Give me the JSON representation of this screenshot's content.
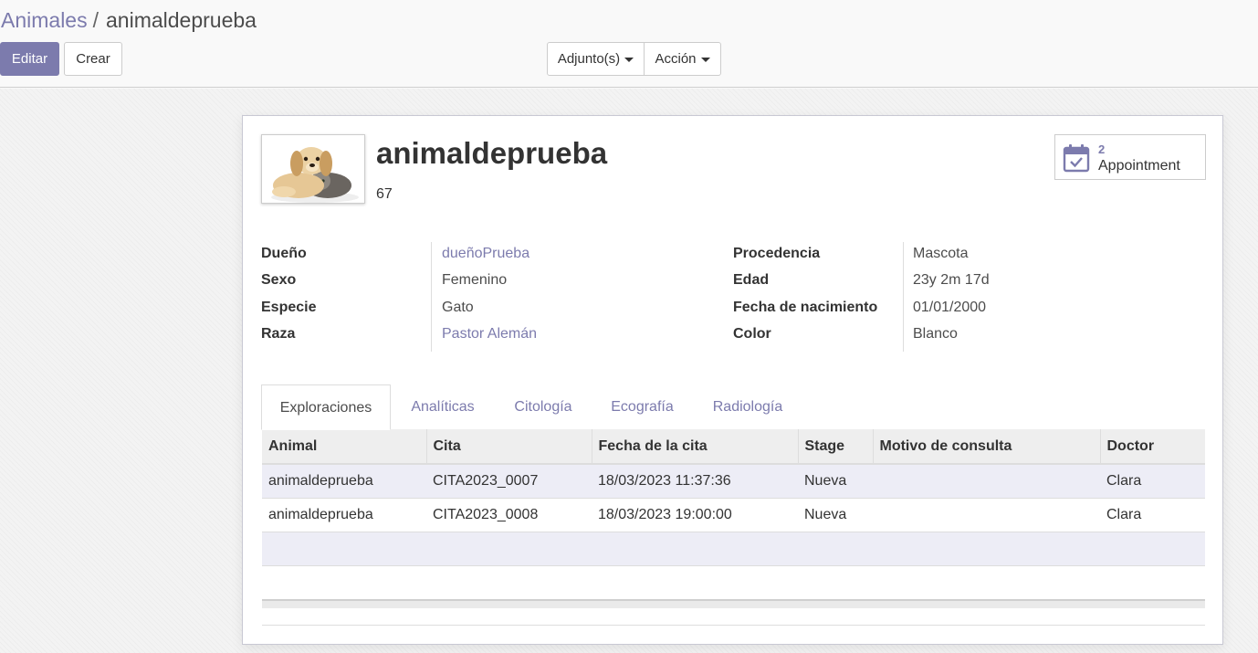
{
  "breadcrumb": {
    "parent": "Animales",
    "current": "animaldeprueba",
    "separator": "/"
  },
  "buttons": {
    "edit": "Editar",
    "create": "Crear",
    "attachments": "Adjunto(s)",
    "action": "Acción"
  },
  "record": {
    "name": "animaldeprueba",
    "number": "67",
    "smart_button": {
      "count": "2",
      "label": "Appointment",
      "icon": "calendar-check-icon"
    }
  },
  "fields_left": [
    {
      "label": "Dueño",
      "value": "dueñoPrueba",
      "link": true
    },
    {
      "label": "Sexo",
      "value": "Femenino",
      "link": false
    },
    {
      "label": "Especie",
      "value": "Gato",
      "link": false
    },
    {
      "label": "Raza",
      "value": "Pastor Alemán",
      "link": true
    }
  ],
  "fields_right": [
    {
      "label": "Procedencia",
      "value": "Mascota"
    },
    {
      "label": "Edad",
      "value": "23y 2m 17d"
    },
    {
      "label": "Fecha de nacimiento",
      "value": "01/01/2000"
    },
    {
      "label": "Color",
      "value": "Blanco"
    }
  ],
  "tabs": [
    "Exploraciones",
    "Analíticas",
    "Citología",
    "Ecografía",
    "Radiología"
  ],
  "active_tab": "Exploraciones",
  "table": {
    "headers": [
      "Animal",
      "Cita",
      "Fecha de la cita",
      "Stage",
      "Motivo de consulta",
      "Doctor"
    ],
    "rows": [
      [
        "animaldeprueba",
        "CITA2023_0007",
        "18/03/2023 11:37:36",
        "Nueva",
        "",
        "Clara"
      ],
      [
        "animaldeprueba",
        "CITA2023_0008",
        "18/03/2023 19:00:00",
        "Nueva",
        "",
        "Clara"
      ]
    ]
  },
  "colors": {
    "accent": "#7c7bad",
    "text": "#4c4c4c"
  }
}
